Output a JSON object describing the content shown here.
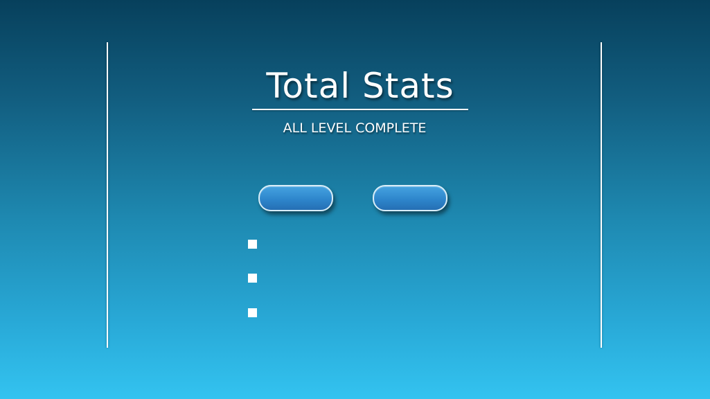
{
  "screen": {
    "title": "Total Stats",
    "subtitle": "ALL LEVEL COMPLETE"
  },
  "buttons": [
    {
      "label": ""
    },
    {
      "label": ""
    }
  ],
  "checkboxes": [
    {
      "checked": false
    },
    {
      "checked": false
    },
    {
      "checked": false
    }
  ],
  "colors": {
    "background_top": "#07405c",
    "background_bottom": "#33c3f0",
    "button_fill": "#2e86cc",
    "button_border": "#d9eef8",
    "text": "#ffffff"
  }
}
